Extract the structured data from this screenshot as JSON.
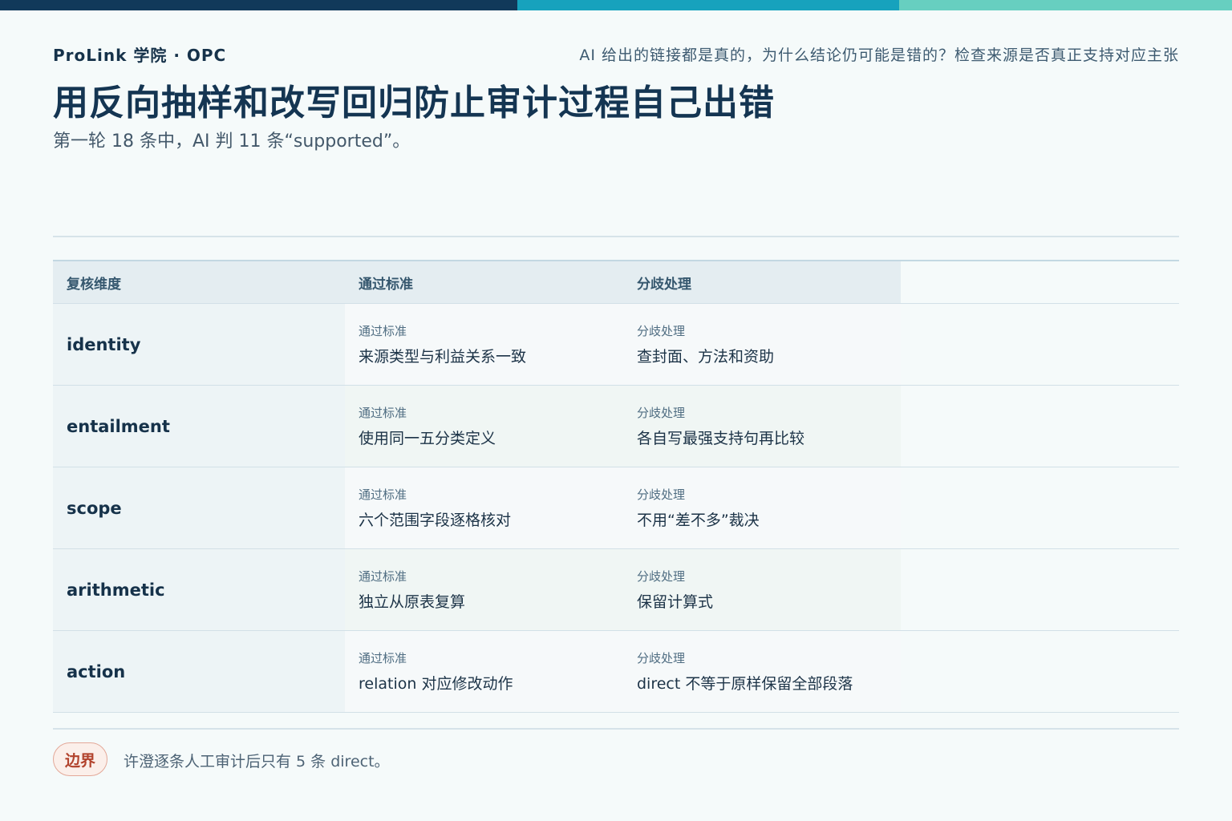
{
  "brand": "ProLink 学院 · OPC",
  "question": "AI 给出的链接都是真的，为什么结论仍可能是错的？检查来源是否真正支持对应主张",
  "title": "用反向抽样和改写回归防止审计过程自己出错",
  "subtitle": "第一轮 18 条中，AI 判 11 条“supported”。",
  "table": {
    "headers": [
      "复核维度",
      "通过标准",
      "分歧处理"
    ],
    "rows": [
      {
        "dimension": "identity",
        "pass_caption": "通过标准",
        "pass": "来源类型与利益关系一致",
        "dispute_caption": "分歧处理",
        "dispute": "查封面、方法和资助"
      },
      {
        "dimension": "entailment",
        "pass_caption": "通过标准",
        "pass": "使用同一五分类定义",
        "dispute_caption": "分歧处理",
        "dispute": "各自写最强支持句再比较"
      },
      {
        "dimension": "scope",
        "pass_caption": "通过标准",
        "pass": "六个范围字段逐格核对",
        "dispute_caption": "分歧处理",
        "dispute": "不用“差不多”裁决"
      },
      {
        "dimension": "arithmetic",
        "pass_caption": "通过标准",
        "pass": "独立从原表复算",
        "dispute_caption": "分歧处理",
        "dispute": "保留计算式"
      },
      {
        "dimension": "action",
        "pass_caption": "通过标准",
        "pass": "relation 对应修改动作",
        "dispute_caption": "分歧处理",
        "dispute": "direct 不等于原样保留全部段落"
      }
    ]
  },
  "footer": {
    "badge": "边界",
    "note": "许澄逐条人工审计后只有 5 条 direct。"
  },
  "colors": {
    "top_bar": [
      "#11395a",
      "#17a2bd",
      "#67cfc0"
    ],
    "title": "#143552",
    "badge_text": "#b2432d"
  }
}
